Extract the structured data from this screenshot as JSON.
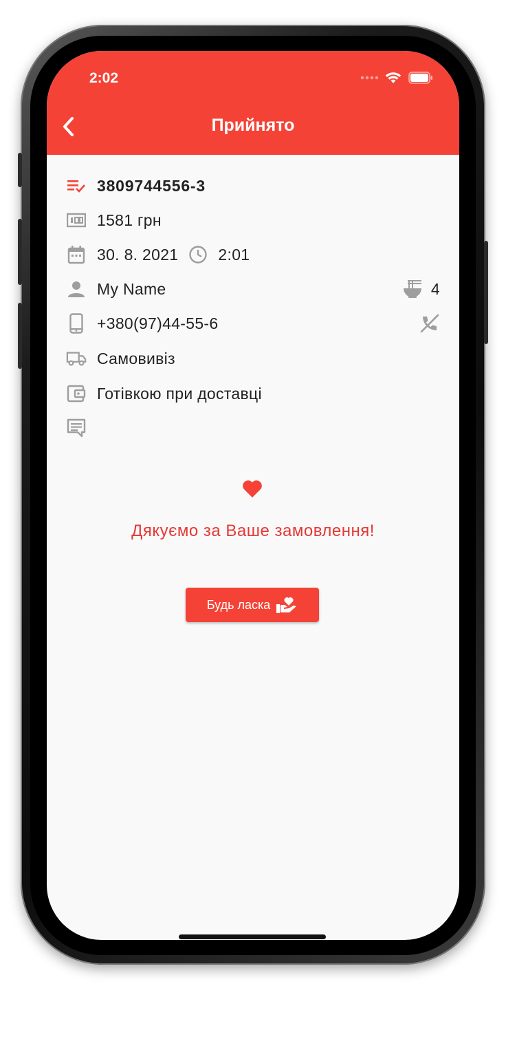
{
  "status_bar": {
    "time": "2:02"
  },
  "header": {
    "title": "Прийнято"
  },
  "order": {
    "number": "3809744556-3",
    "total": "1581 грн",
    "date": "30. 8. 2021",
    "time": "2:01",
    "customer_name": "My Name",
    "persons": "4",
    "phone": "+380(97)44-55-6",
    "delivery": "Самовивіз",
    "payment": "Готівкою при доставці",
    "comment": ""
  },
  "thanks_message": "Дякуємо за Ваше замовлення!",
  "donate_button": {
    "label": "Будь ласка"
  },
  "colors": {
    "accent": "#f44336",
    "thanks_text": "#e53935",
    "icon_gray": "#9e9e9e"
  }
}
